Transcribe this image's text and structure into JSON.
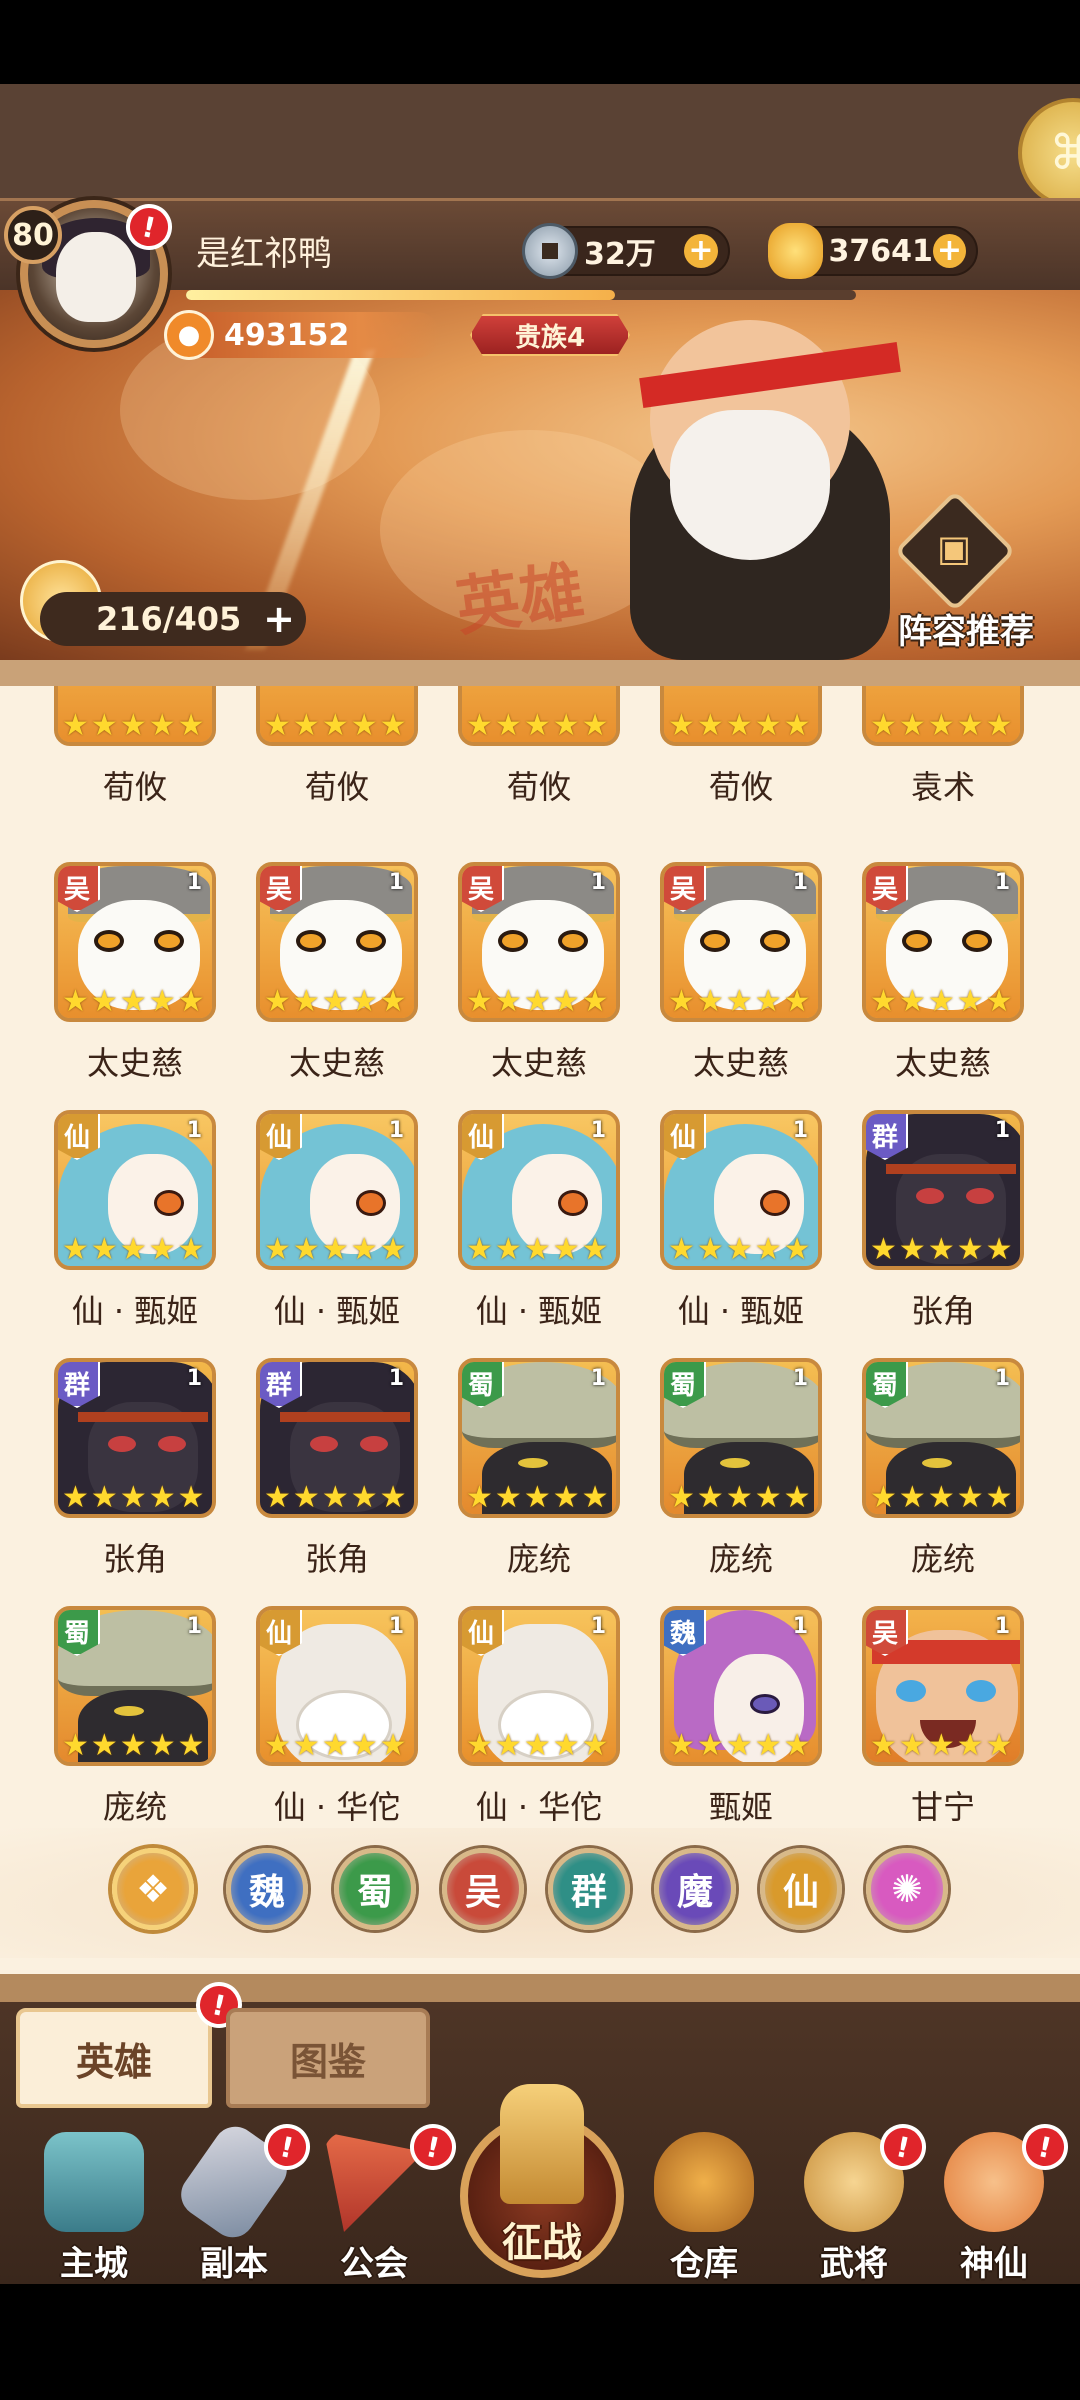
{
  "player": {
    "level": "80",
    "name": "是红祁鸭",
    "power": "493152",
    "noble": "贵族4",
    "stamina": "216/405"
  },
  "currency": {
    "silver": "32万",
    "gold": "37641"
  },
  "banner": {
    "watermark": "英雄",
    "recommend_label": "阵容推荐"
  },
  "faction_colors": {
    "吴": "#d04a3a",
    "仙": "#d79a32",
    "群": "#6b5bc4",
    "蜀": "#3c9a4a",
    "魏": "#3f6fc1"
  },
  "heroes": [
    {
      "name": "荀攸",
      "faction": "",
      "count": "",
      "art": "partial"
    },
    {
      "name": "荀攸",
      "faction": "",
      "count": "",
      "art": "partial"
    },
    {
      "name": "荀攸",
      "faction": "",
      "count": "",
      "art": "partial"
    },
    {
      "name": "荀攸",
      "faction": "",
      "count": "",
      "art": "partial"
    },
    {
      "name": "袁术",
      "faction": "",
      "count": "",
      "art": "partial"
    },
    {
      "name": "太史慈",
      "faction": "吴",
      "count": "1",
      "art": "wu"
    },
    {
      "name": "太史慈",
      "faction": "吴",
      "count": "1",
      "art": "wu"
    },
    {
      "name": "太史慈",
      "faction": "吴",
      "count": "1",
      "art": "wu"
    },
    {
      "name": "太史慈",
      "faction": "吴",
      "count": "1",
      "art": "wu"
    },
    {
      "name": "太史慈",
      "faction": "吴",
      "count": "1",
      "art": "wu"
    },
    {
      "name": "仙 · 甄姬",
      "faction": "仙",
      "count": "1",
      "art": "xian"
    },
    {
      "name": "仙 · 甄姬",
      "faction": "仙",
      "count": "1",
      "art": "xian"
    },
    {
      "name": "仙 · 甄姬",
      "faction": "仙",
      "count": "1",
      "art": "xian"
    },
    {
      "name": "仙 · 甄姬",
      "faction": "仙",
      "count": "1",
      "art": "xian"
    },
    {
      "name": "张角",
      "faction": "群",
      "count": "1",
      "art": "qun"
    },
    {
      "name": "张角",
      "faction": "群",
      "count": "1",
      "art": "qun"
    },
    {
      "name": "张角",
      "faction": "群",
      "count": "1",
      "art": "qun"
    },
    {
      "name": "庞统",
      "faction": "蜀",
      "count": "1",
      "art": "shu"
    },
    {
      "name": "庞统",
      "faction": "蜀",
      "count": "1",
      "art": "shu"
    },
    {
      "name": "庞统",
      "faction": "蜀",
      "count": "1",
      "art": "shu"
    },
    {
      "name": "庞统",
      "faction": "蜀",
      "count": "1",
      "art": "shu"
    },
    {
      "name": "仙 · 华佗",
      "faction": "仙",
      "count": "1",
      "art": "hua"
    },
    {
      "name": "仙 · 华佗",
      "faction": "仙",
      "count": "1",
      "art": "hua"
    },
    {
      "name": "甄姬",
      "faction": "魏",
      "count": "1",
      "art": "wei"
    },
    {
      "name": "甘宁",
      "faction": "吴",
      "count": "1",
      "art": "gan"
    }
  ],
  "filters": [
    {
      "label": "",
      "icon": "paw-icon",
      "color": "#e9a43a",
      "active": true
    },
    {
      "label": "魏",
      "icon": "",
      "color": "#3f6fc1",
      "active": false
    },
    {
      "label": "蜀",
      "icon": "",
      "color": "#3c9a4a",
      "active": false
    },
    {
      "label": "吴",
      "icon": "",
      "color": "#c94a3a",
      "active": false
    },
    {
      "label": "群",
      "icon": "",
      "color": "#2f8f86",
      "active": false
    },
    {
      "label": "魔",
      "icon": "",
      "color": "#6a4ab8",
      "active": false
    },
    {
      "label": "仙",
      "icon": "",
      "color": "#d99a2c",
      "active": false
    },
    {
      "label": "",
      "icon": "swirl-icon",
      "color": "#d85ac0",
      "active": false
    }
  ],
  "tabs": {
    "heroes": "英雄",
    "codex": "图鉴"
  },
  "nav": {
    "main_city": "主城",
    "dungeon": "副本",
    "guild": "公会",
    "campaign": "征战",
    "warehouse": "仓库",
    "generals": "武将",
    "immortals": "神仙"
  },
  "alerts": {
    "mark": "!"
  }
}
